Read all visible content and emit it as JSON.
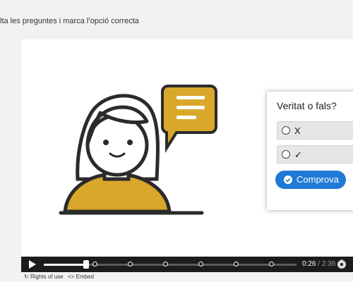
{
  "instructions": "lta les preguntes i marca l’opció correcta",
  "quiz": {
    "title": "Veritat o fals?",
    "options": [
      {
        "label": "X"
      },
      {
        "label": "✓"
      }
    ],
    "check_label": "Comprova"
  },
  "player": {
    "current_time": "0:26",
    "separator": " / ",
    "total_time": "2:36",
    "progress": 0.167,
    "marker_positions": [
      0.2,
      0.34,
      0.48,
      0.62,
      0.76,
      0.9
    ]
  },
  "footer": {
    "rights_label": "Rights of use",
    "embed_label": "Embed"
  },
  "colors": {
    "accent": "#1f7ad6",
    "illustration_yellow": "#d9a82b",
    "player_bar": "#1c1c1c"
  },
  "icons": [
    "play-icon",
    "settings-icon",
    "rights-icon",
    "embed-icon",
    "check-icon"
  ]
}
